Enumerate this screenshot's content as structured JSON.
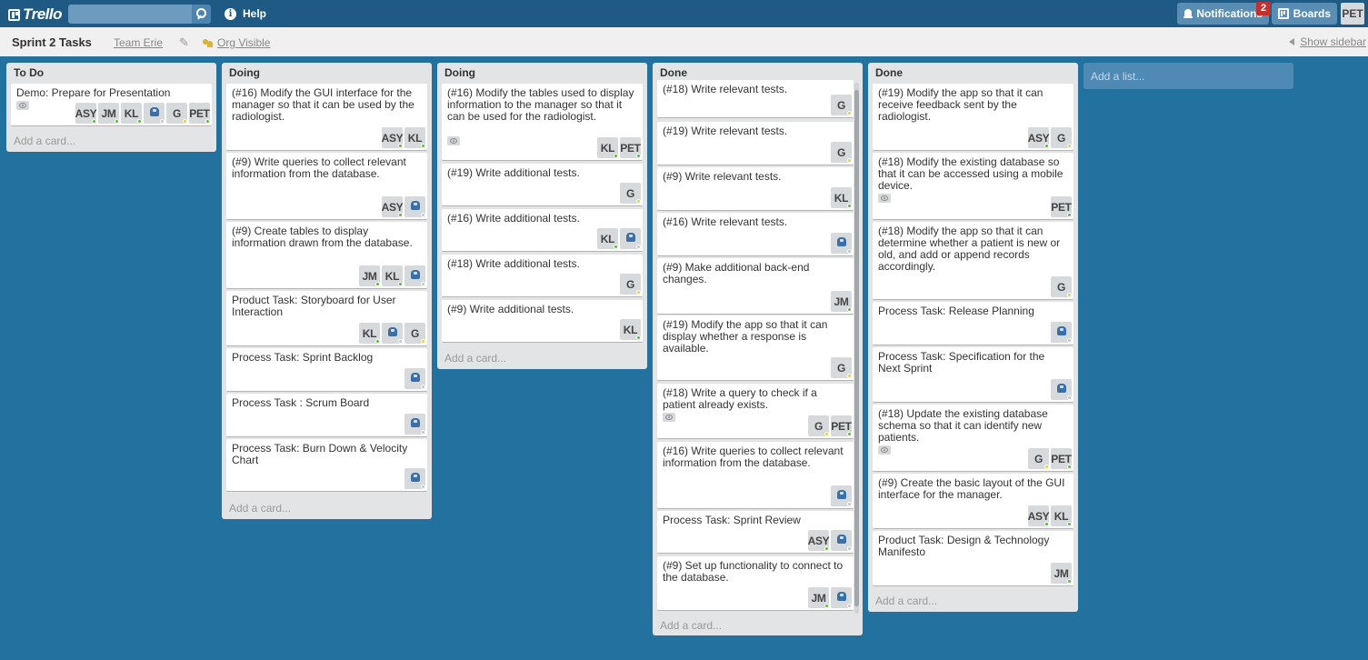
{
  "topbar": {
    "logo": "Trello",
    "search_placeholder": "",
    "help": "Help",
    "notifications": "Notifications",
    "notif_count": "2",
    "boards": "Boards",
    "me": "PET"
  },
  "board": {
    "title": "Sprint 2 Tasks",
    "team": "Team Erie",
    "visibility": "Org Visible",
    "show_sidebar": "Show sidebar"
  },
  "status_colors": {
    "green": "#5ab83a",
    "yellow": "#e8d23a"
  },
  "add_list": "Add a list...",
  "lists": [
    {
      "title": "To Do",
      "add_card": "Add a card...",
      "cards": [
        {
          "title": "Demo: Prepare for Presentation",
          "eye": true,
          "members": [
            [
              "ASY",
              "green"
            ],
            [
              "JM",
              "green"
            ],
            [
              "KL",
              "green"
            ],
            [
              "robot",
              "gray"
            ],
            [
              "G",
              "yellow"
            ],
            [
              "PET",
              "green"
            ]
          ]
        }
      ]
    },
    {
      "title": "Doing",
      "add_card": "Add a card...",
      "cards": [
        {
          "title": "(#16) Modify the GUI interface for the manager so that it can be used by the radiologist.",
          "eye": false,
          "members": [
            [
              "ASY",
              "green"
            ],
            [
              "KL",
              "green"
            ]
          ]
        },
        {
          "title": "(#9) Write queries to collect relevant information from the database.",
          "eye": false,
          "members": [
            [
              "ASY",
              "green"
            ],
            [
              "robot",
              "gray"
            ]
          ]
        },
        {
          "title": "(#9) Create tables to display information drawn from the database.",
          "eye": false,
          "members": [
            [
              "JM",
              "green"
            ],
            [
              "KL",
              "green"
            ],
            [
              "robot",
              "gray"
            ]
          ]
        },
        {
          "title": "Product Task: Storyboard for User Interaction",
          "eye": false,
          "members": [
            [
              "KL",
              "green"
            ],
            [
              "robot",
              "gray"
            ],
            [
              "G",
              "yellow"
            ]
          ]
        },
        {
          "title": "Process Task: Sprint Backlog",
          "eye": false,
          "members": [
            [
              "robot",
              "gray"
            ]
          ]
        },
        {
          "title": "Process Task : Scrum Board",
          "eye": false,
          "members": [
            [
              "robot",
              "gray"
            ]
          ]
        },
        {
          "title": "Process Task: Burn Down & Velocity Chart",
          "eye": false,
          "members": [
            [
              "robot",
              "gray"
            ]
          ]
        }
      ]
    },
    {
      "title": "Doing",
      "add_card": "Add a card...",
      "cards": [
        {
          "title": "(#16) Modify the tables used to display information to the manager so that it can be used for the radiologist.",
          "eye": true,
          "members": [
            [
              "KL",
              "green"
            ],
            [
              "PET",
              "green"
            ]
          ]
        },
        {
          "title": "(#19) Write additional tests.",
          "eye": false,
          "members": [
            [
              "G",
              "yellow"
            ]
          ]
        },
        {
          "title": "(#16) Write additional tests.",
          "eye": false,
          "members": [
            [
              "KL",
              "green"
            ],
            [
              "robot",
              "gray"
            ]
          ]
        },
        {
          "title": "(#18) Write additional tests.",
          "eye": false,
          "members": [
            [
              "G",
              "yellow"
            ]
          ]
        },
        {
          "title": "(#9) Write additional tests.",
          "eye": false,
          "members": [
            [
              "KL",
              "green"
            ]
          ]
        }
      ]
    },
    {
      "title": "Done",
      "add_card": "Add a card...",
      "cards": [
        {
          "title": "(#18) Write relevant tests.",
          "eye": false,
          "members": [
            [
              "G",
              "yellow"
            ]
          ]
        },
        {
          "title": "(#19) Write relevant tests.",
          "eye": false,
          "members": [
            [
              "G",
              "yellow"
            ]
          ]
        },
        {
          "title": "(#9) Write relevant tests.",
          "eye": false,
          "members": [
            [
              "KL",
              "green"
            ]
          ]
        },
        {
          "title": "(#16) Write relevant tests.",
          "eye": false,
          "members": [
            [
              "robot",
              "gray"
            ]
          ]
        },
        {
          "title": "(#9) Make additional back-end changes.",
          "eye": false,
          "members": [
            [
              "JM",
              "green"
            ]
          ]
        },
        {
          "title": "(#19) Modify the app so that it can display whether a response is available.",
          "eye": false,
          "members": [
            [
              "G",
              "yellow"
            ]
          ]
        },
        {
          "title": "(#18) Write a query to check if a patient already exists.",
          "eye": true,
          "members": [
            [
              "G",
              "yellow"
            ],
            [
              "PET",
              "green"
            ]
          ]
        },
        {
          "title": "(#16) Write queries to collect relevant information from the database.",
          "eye": false,
          "members": [
            [
              "robot",
              "gray"
            ]
          ]
        },
        {
          "title": "Process Task: Sprint Review",
          "eye": false,
          "members": [
            [
              "ASY",
              "green"
            ],
            [
              "robot",
              "gray"
            ]
          ]
        },
        {
          "title": "(#9) Set up functionality to connect to the database.",
          "eye": false,
          "members": [
            [
              "JM",
              "green"
            ],
            [
              "robot",
              "gray"
            ]
          ]
        }
      ]
    },
    {
      "title": "Done",
      "add_card": "Add a card...",
      "cards": [
        {
          "title": "(#19) Modify the app so that it can receive feedback sent by the radiologist.",
          "eye": false,
          "members": [
            [
              "ASY",
              "green"
            ],
            [
              "G",
              "yellow"
            ]
          ]
        },
        {
          "title": "(#18) Modify the existing database so that it can be accessed using a mobile device.",
          "eye": true,
          "members": [
            [
              "PET",
              "green"
            ]
          ]
        },
        {
          "title": "(#18) Modify the app so that it can determine whether a patient is new or old, and add or append records accordingly.",
          "eye": false,
          "members": [
            [
              "G",
              "yellow"
            ]
          ]
        },
        {
          "title": "Process Task: Release Planning",
          "eye": false,
          "members": [
            [
              "robot",
              "gray"
            ]
          ]
        },
        {
          "title": "Process Task: Specification for the Next Sprint",
          "eye": false,
          "members": [
            [
              "robot",
              "gray"
            ]
          ]
        },
        {
          "title": "(#18) Update the existing database schema so that it can identify new patients.",
          "eye": true,
          "members": [
            [
              "G",
              "yellow"
            ],
            [
              "PET",
              "green"
            ]
          ]
        },
        {
          "title": "(#9) Create the basic layout of the GUI interface for the manager.",
          "eye": false,
          "members": [
            [
              "ASY",
              "green"
            ],
            [
              "KL",
              "green"
            ]
          ]
        },
        {
          "title": "Product Task: Design & Technology Manifesto",
          "eye": false,
          "members": [
            [
              "JM",
              "green"
            ]
          ]
        }
      ]
    }
  ]
}
